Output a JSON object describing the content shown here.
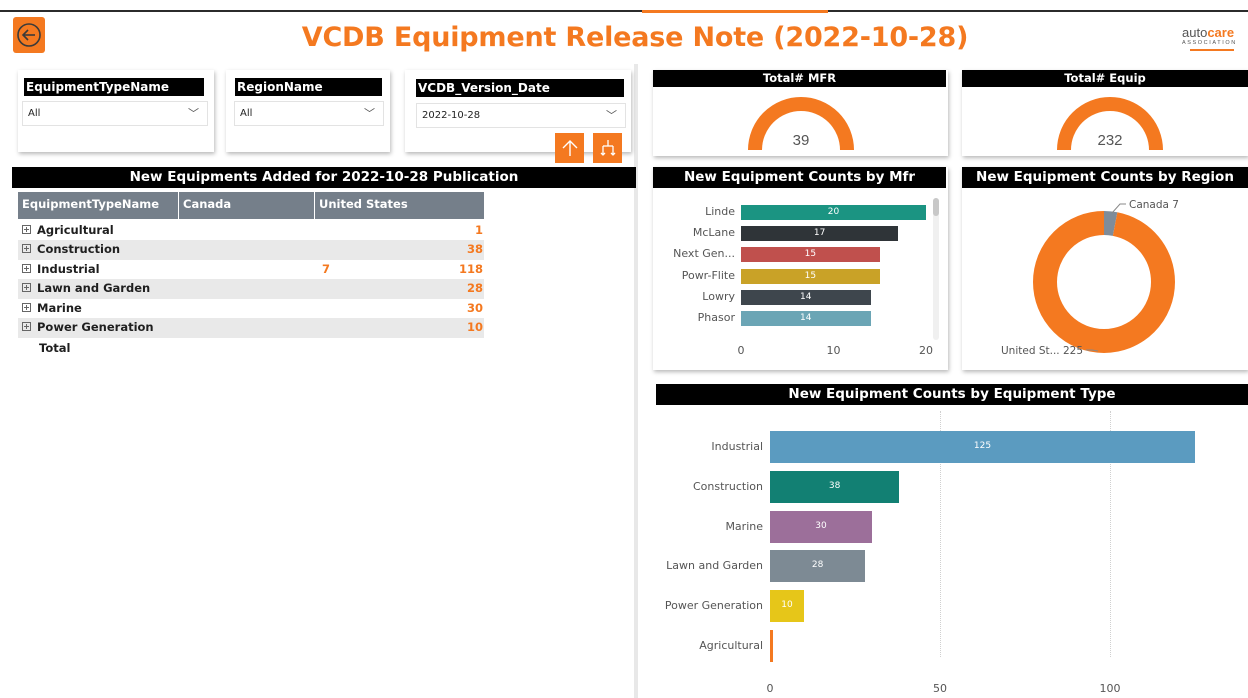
{
  "header": {
    "title": "VCDB Equipment Release Note (2022-10-28)",
    "back_icon": "arrow-left-circle-icon",
    "logo": {
      "auto": "auto",
      "care": "care",
      "association": "ASSOCIATION"
    },
    "accent_color": "#f47920"
  },
  "slicers": {
    "equipment_type": {
      "title": "EquipmentTypeName",
      "value": "All"
    },
    "region": {
      "title": "RegionName",
      "value": "All"
    },
    "version_date": {
      "title": "VCDB_Version_Date",
      "value": "2022-10-28"
    },
    "sort_up_icon": "arrow-up-icon",
    "sort_hierarchy_icon": "expand-hierarchy-icon"
  },
  "matrix": {
    "title": "New Equipments Added for 2022-10-28 Publication",
    "columns": [
      "EquipmentTypeName",
      "Canada",
      "United States"
    ],
    "rows": [
      {
        "name": "Agricultural",
        "canada": "",
        "us": "1"
      },
      {
        "name": "Construction",
        "canada": "",
        "us": "38"
      },
      {
        "name": "Industrial",
        "canada": "7",
        "us": "118"
      },
      {
        "name": "Lawn and Garden",
        "canada": "",
        "us": "28"
      },
      {
        "name": "Marine",
        "canada": "",
        "us": "30"
      },
      {
        "name": "Power Generation",
        "canada": "",
        "us": "10"
      }
    ],
    "total_label": "Total"
  },
  "kpis": {
    "mfr": {
      "title": "Total# MFR",
      "value": "39"
    },
    "equip": {
      "title": "Total# Equip",
      "value": "232"
    }
  },
  "chart_data": [
    {
      "type": "bar",
      "title": "New Equipment Counts by Mfr",
      "orientation": "horizontal",
      "categories": [
        "Linde",
        "McLane",
        "Next Gen...",
        "Powr-Flite",
        "Lowry",
        "Phasor"
      ],
      "values": [
        20,
        17,
        15,
        15,
        14,
        14
      ],
      "colors": [
        "#1b9482",
        "#2f3438",
        "#c0504d",
        "#c9a227",
        "#3e464d",
        "#6ba5b5"
      ],
      "xticks": [
        "0",
        "10",
        "20"
      ],
      "xlim": [
        0,
        20
      ]
    },
    {
      "type": "pie",
      "title": "New Equipment Counts by Region",
      "categories": [
        "Canada",
        "United States"
      ],
      "values": [
        7,
        225
      ],
      "labels": [
        "Canada 7",
        "United St... 225"
      ],
      "colors": [
        "#7f8c99",
        "#f47920"
      ]
    },
    {
      "type": "bar",
      "title": "New Equipment Counts by Equipment Type",
      "orientation": "horizontal",
      "categories": [
        "Industrial",
        "Construction",
        "Marine",
        "Lawn and Garden",
        "Power Generation",
        "Agricultural"
      ],
      "values": [
        125,
        38,
        30,
        28,
        10,
        1
      ],
      "value_labels": [
        "125",
        "38",
        "30",
        "28",
        "10",
        ""
      ],
      "colors": [
        "#5b9bc0",
        "#128073",
        "#9c6f9a",
        "#7d8a94",
        "#e6c619",
        "#f47920"
      ],
      "xticks": [
        "0",
        "50",
        "100"
      ],
      "xlim": [
        0,
        125
      ]
    },
    {
      "type": "gauge",
      "title": "Total# MFR",
      "value": 39
    },
    {
      "type": "gauge",
      "title": "Total# Equip",
      "value": 232
    }
  ]
}
